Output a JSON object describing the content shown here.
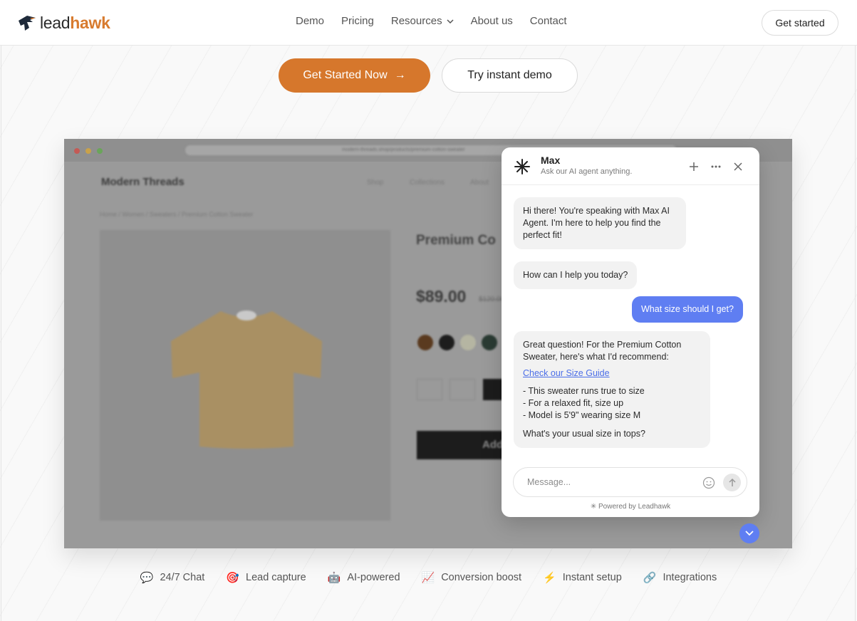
{
  "brand": {
    "lead": "lead",
    "hawk": "hawk",
    "accent": "#d6772c"
  },
  "nav": {
    "links": [
      "Demo",
      "Pricing",
      "Resources",
      "About us",
      "Contact"
    ],
    "get_started": "Get started"
  },
  "hero": {
    "primary_cta": "Get Started Now",
    "secondary_cta": "Try instant demo"
  },
  "demo_store": {
    "url": "modern-threads.shop/products/premium-cotton-sweater",
    "store_name": "Modern Threads",
    "nav": [
      "Shop",
      "Collections",
      "About"
    ],
    "breadcrumb": "Home / Women / Sweaters / Premium Cotton Sweater",
    "product_title": "Premium Co",
    "price": "$89.00",
    "old_price": "$120.00",
    "add_button": "Add",
    "swatch_colors": [
      "#5a3a1f",
      "#1d1d1d",
      "#b5b5a2",
      "#2a3b33"
    ]
  },
  "chat": {
    "agent_name": "Max",
    "agent_subtitle": "Ask our AI agent anything.",
    "messages": {
      "m1": "Hi there! You're speaking with Max AI Agent. I'm here to help you find the perfect fit!",
      "m2": "How can I help you today?",
      "m3": "What size should I get?",
      "m4_intro": "Great question! For the Premium Cotton Sweater, here's what I'd recommend:",
      "m4_link": "Check our Size Guide",
      "m4_list": [
        "- This sweater runs true to size",
        "- For a relaxed fit, size up",
        "- Model is 5'9\" wearing size M"
      ],
      "m4_question": "What's your usual size in tops?"
    },
    "input_placeholder": "Message...",
    "powered_by": "Powered by Leadhawk",
    "user_bubble_color": "#5f7ef2"
  },
  "features": [
    {
      "icon": "💬",
      "label": "24/7 Chat"
    },
    {
      "icon": "🎯",
      "label": "Lead capture"
    },
    {
      "icon": "🤖",
      "label": "AI-powered"
    },
    {
      "icon": "📈",
      "label": "Conversion boost"
    },
    {
      "icon": "⚡",
      "label": "Instant setup"
    },
    {
      "icon": "🔗",
      "label": "Integrations"
    }
  ]
}
